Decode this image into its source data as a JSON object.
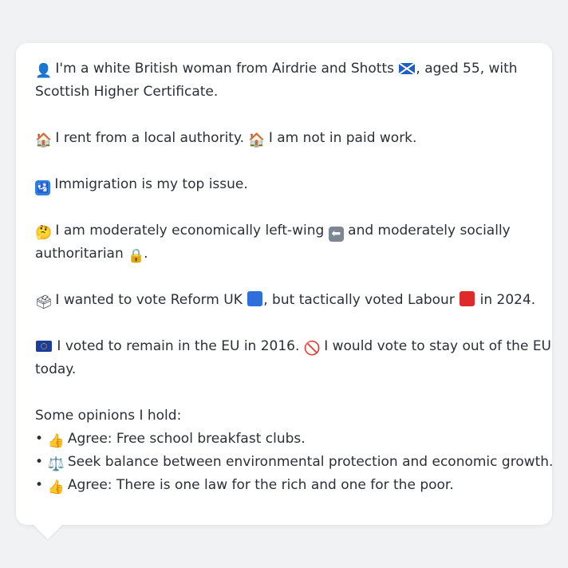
{
  "profile": {
    "line1a": "I'm a white British woman from Airdrie and Shotts",
    "line1b": ", aged 55, with",
    "line2": "Scottish Higher Certificate.",
    "housing_a": "I rent from a local authority.",
    "housing_b": "I am not in paid work.",
    "issue": "Immigration is my top issue.",
    "ideology_a": "I am moderately economically left-wing",
    "ideology_b": "and moderately socially",
    "ideology_c": "authoritarian",
    "ideology_c_end": ".",
    "vote_a": "I wanted to vote Reform UK",
    "vote_b": ", but tactically voted Labour",
    "vote_c": "in 2024.",
    "eu_a": "I voted to remain in the EU in 2016.",
    "eu_b": "I would vote to stay out of the EU",
    "eu_c": "today."
  },
  "opinions": {
    "heading": "Some opinions I hold:",
    "bullet": "•",
    "items": [
      {
        "text": "Agree: Free school breakfast clubs.",
        "icon": "thumbs-up-icon"
      },
      {
        "text": "Seek balance between environmental protection and economic growth.",
        "icon": "scales-icon"
      },
      {
        "text": "Agree: There is one law for the rich and one for the poor.",
        "icon": "thumbs-up-icon"
      }
    ]
  },
  "icons": {
    "person": "👤",
    "house": "🏠",
    "think": "🤔",
    "lock": "🔒",
    "ballot": "🗳",
    "no": "🚫",
    "thumbs": "👍",
    "scales": "⚖️",
    "left_arrow": "⬅",
    "immigration": "🛂"
  },
  "colors": {
    "background": "#f1f2f4",
    "card": "#ffffff",
    "text": "#2b2f36",
    "reform_blue": "#2e6fdb",
    "labour_red": "#e0292b"
  }
}
